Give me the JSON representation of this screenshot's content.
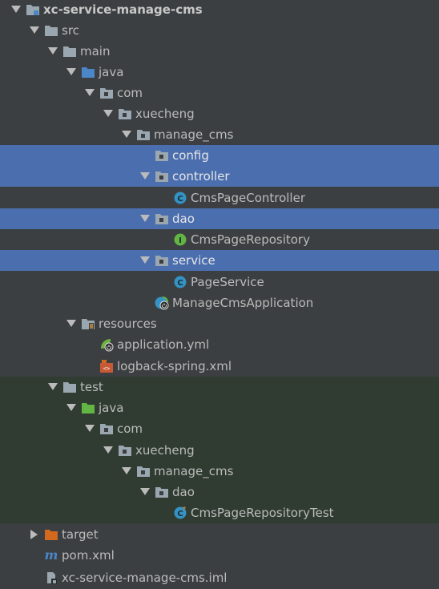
{
  "project_tree": {
    "root": "xc-service-manage-cms",
    "items": [
      {
        "label": "xc-service-manage-cms",
        "expanded": true,
        "icon": "module-folder-icon",
        "selected": false,
        "test": false
      },
      {
        "label": "src",
        "expanded": true,
        "icon": "folder-icon",
        "selected": false,
        "test": false
      },
      {
        "label": "main",
        "expanded": true,
        "icon": "folder-icon",
        "selected": false,
        "test": false
      },
      {
        "label": "java",
        "expanded": true,
        "icon": "source-root-folder-icon",
        "selected": false,
        "test": false
      },
      {
        "label": "com",
        "expanded": true,
        "icon": "package-icon",
        "selected": false,
        "test": false
      },
      {
        "label": "xuecheng",
        "expanded": true,
        "icon": "package-icon",
        "selected": false,
        "test": false
      },
      {
        "label": "manage_cms",
        "expanded": true,
        "icon": "package-icon",
        "selected": false,
        "test": false
      },
      {
        "label": "config",
        "expanded": null,
        "icon": "package-icon",
        "selected": true,
        "test": false
      },
      {
        "label": "controller",
        "expanded": true,
        "icon": "package-icon",
        "selected": true,
        "test": false
      },
      {
        "label": "CmsPageController",
        "expanded": null,
        "icon": "class-icon",
        "selected": false,
        "test": false
      },
      {
        "label": "dao",
        "expanded": true,
        "icon": "package-icon",
        "selected": true,
        "test": false
      },
      {
        "label": "CmsPageRepository",
        "expanded": null,
        "icon": "interface-icon",
        "selected": false,
        "test": false
      },
      {
        "label": "service",
        "expanded": true,
        "icon": "package-icon",
        "selected": true,
        "test": false
      },
      {
        "label": "PageService",
        "expanded": null,
        "icon": "class-icon",
        "selected": false,
        "test": false
      },
      {
        "label": "ManageCmsApplication",
        "expanded": null,
        "icon": "spring-boot-class-icon",
        "selected": false,
        "test": false
      },
      {
        "label": "resources",
        "expanded": true,
        "icon": "resources-folder-icon",
        "selected": false,
        "test": false
      },
      {
        "label": "application.yml",
        "expanded": null,
        "icon": "spring-yml-icon",
        "selected": false,
        "test": false
      },
      {
        "label": "logback-spring.xml",
        "expanded": null,
        "icon": "xml-file-icon",
        "selected": false,
        "test": false
      },
      {
        "label": "test",
        "expanded": true,
        "icon": "folder-icon",
        "selected": false,
        "test": true
      },
      {
        "label": "java",
        "expanded": true,
        "icon": "test-source-folder-icon",
        "selected": false,
        "test": true
      },
      {
        "label": "com",
        "expanded": true,
        "icon": "package-icon",
        "selected": false,
        "test": true
      },
      {
        "label": "xuecheng",
        "expanded": true,
        "icon": "package-icon",
        "selected": false,
        "test": true
      },
      {
        "label": "manage_cms",
        "expanded": true,
        "icon": "package-icon",
        "selected": false,
        "test": true
      },
      {
        "label": "dao",
        "expanded": true,
        "icon": "package-icon",
        "selected": false,
        "test": true
      },
      {
        "label": "CmsPageRepositoryTest",
        "expanded": null,
        "icon": "test-class-icon",
        "selected": false,
        "test": true
      },
      {
        "label": "target",
        "expanded": false,
        "icon": "excluded-folder-icon",
        "selected": false,
        "test": false
      },
      {
        "label": "pom.xml",
        "expanded": null,
        "icon": "maven-icon",
        "selected": false,
        "test": false
      },
      {
        "label": "xc-service-manage-cms.iml",
        "expanded": null,
        "icon": "iml-file-icon",
        "selected": false,
        "test": false
      }
    ]
  },
  "colors": {
    "background": "#3c3f41",
    "selection": "#4b6eaf",
    "test_background": "#303c31",
    "folder": "#9aa7b0",
    "source_root": "#4a86c8",
    "test_root": "#62b543",
    "excluded": "#d2691e",
    "class_badge": "#3592c4",
    "interface_badge": "#62b543"
  }
}
